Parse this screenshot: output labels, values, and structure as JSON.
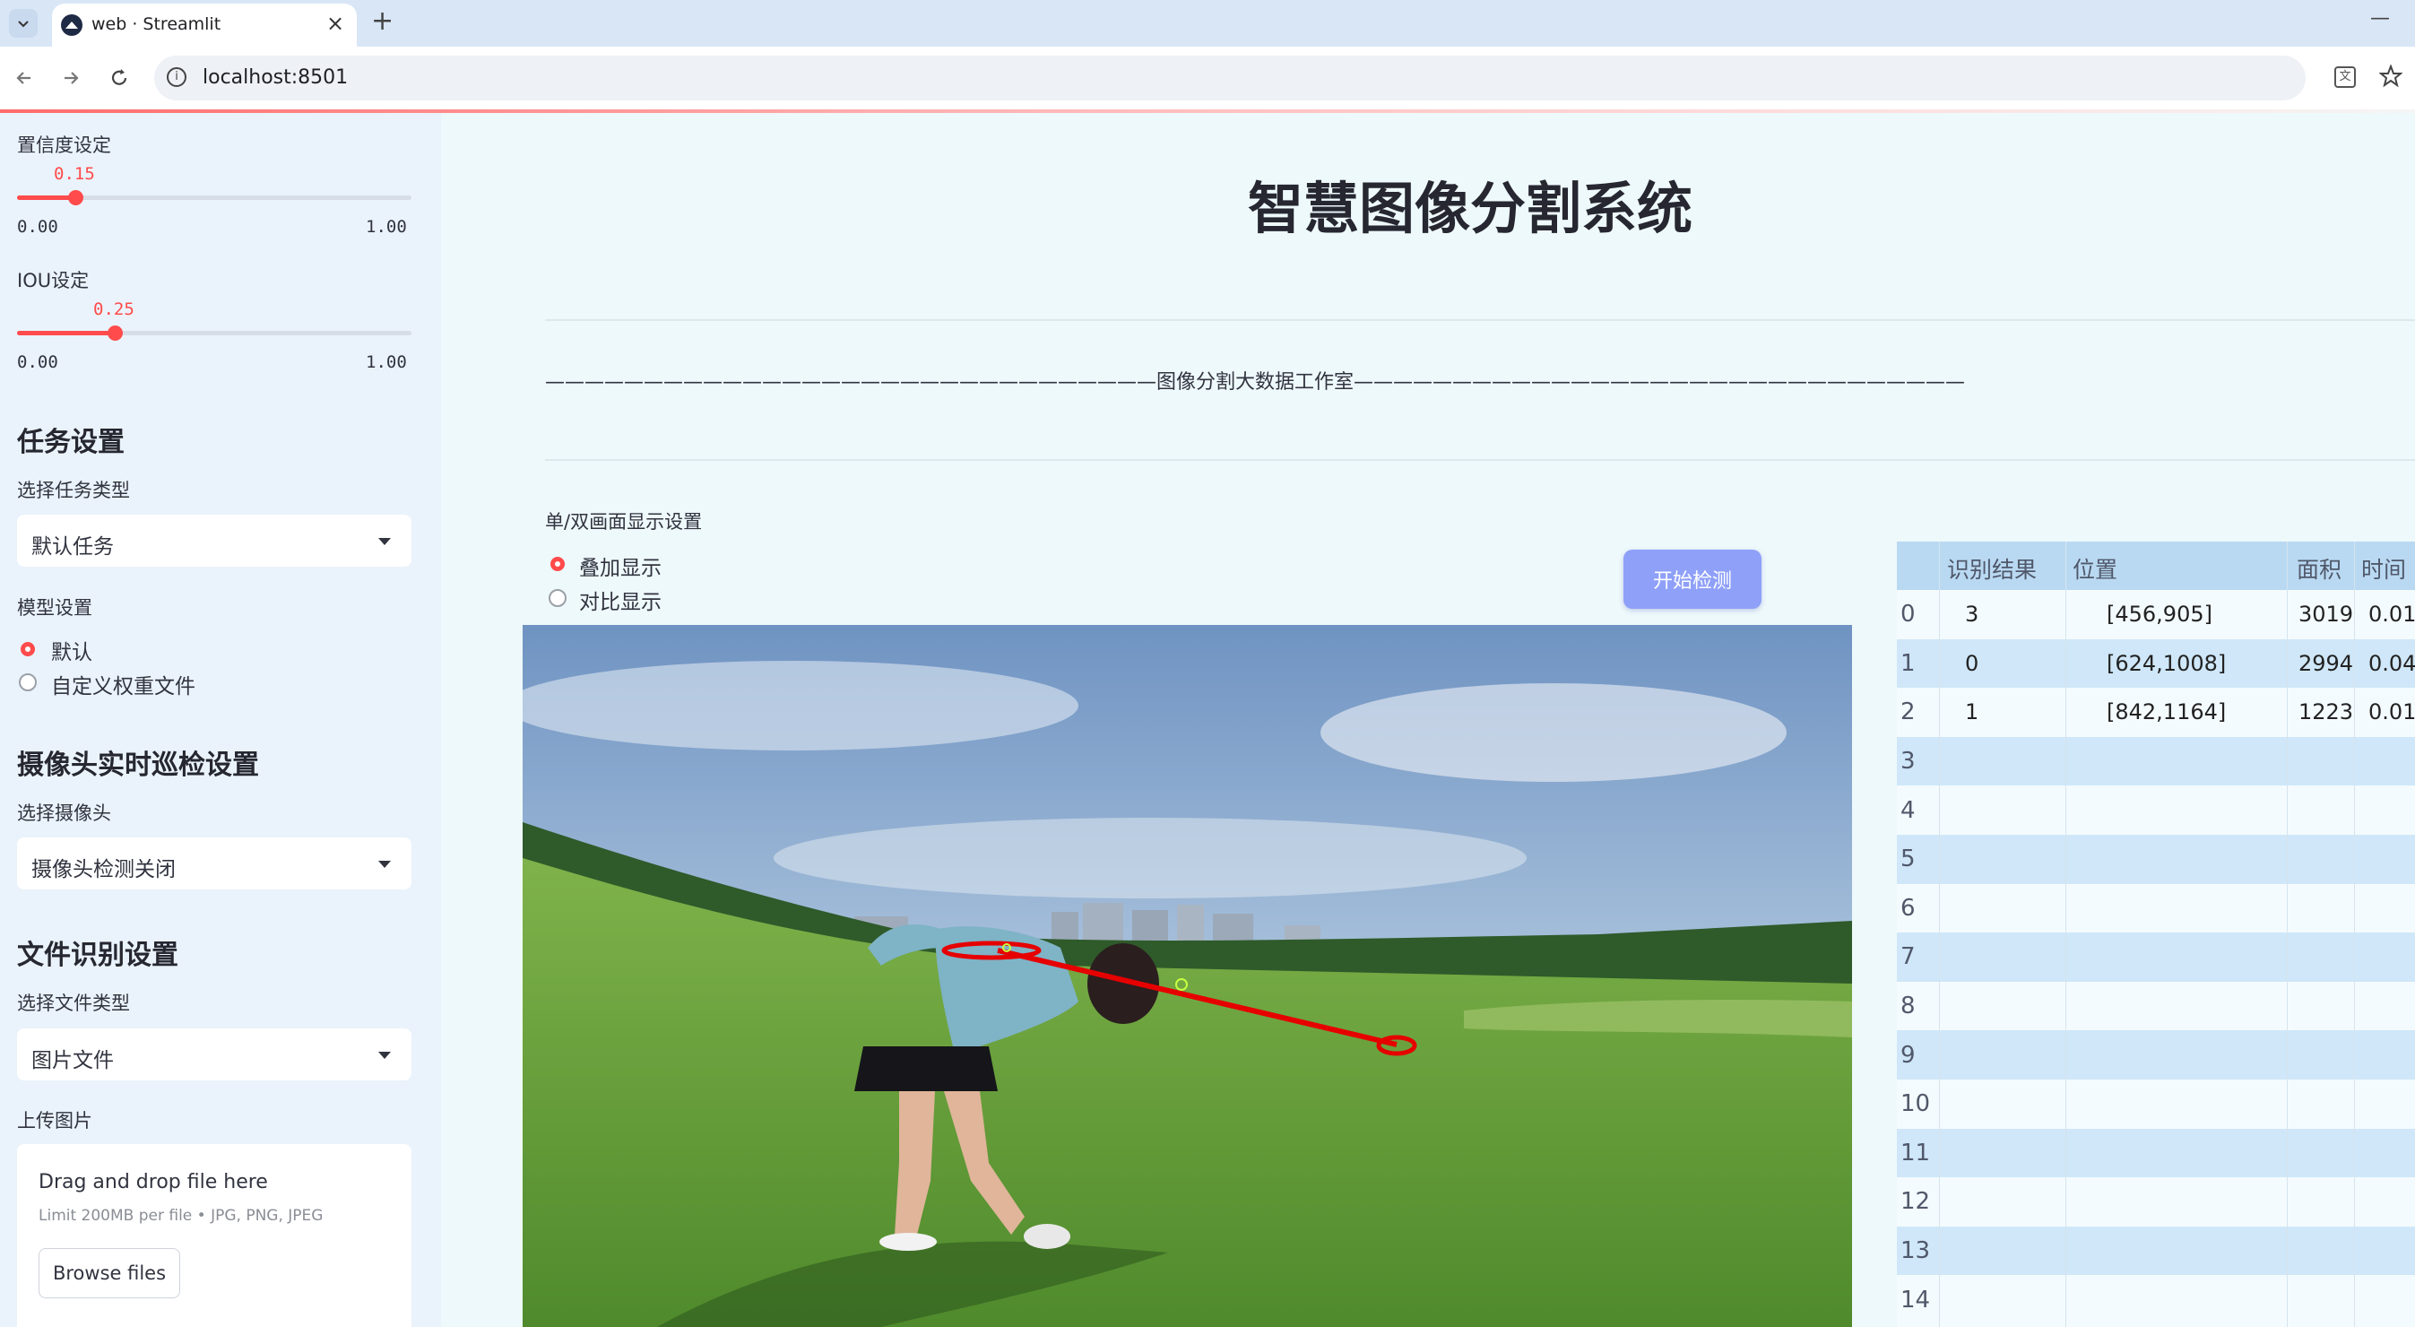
{
  "browser": {
    "tab_title": "web · Streamlit",
    "tab_close": "×",
    "new_tab": "+",
    "url": "localhost:8501",
    "minimize": "—"
  },
  "sidebar": {
    "confidence": {
      "label": "置信度设定",
      "value": "0.15",
      "value_fraction": 0.15,
      "min": "0.00",
      "max": "1.00"
    },
    "iou": {
      "label": "IOU设定",
      "value": "0.25",
      "value_fraction": 0.25,
      "min": "0.00",
      "max": "1.00"
    },
    "task_section": {
      "title": "任务设置",
      "select_label": "选择任务类型",
      "selected": "默认任务"
    },
    "model_section": {
      "label": "模型设置",
      "options": [
        "默认",
        "自定义权重文件"
      ],
      "selected_index": 0
    },
    "camera_section": {
      "title": "摄像头实时巡检设置",
      "select_label": "选择摄像头",
      "selected": "摄像头检测关闭"
    },
    "file_section": {
      "title": "文件识别设置",
      "select_label": "选择文件类型",
      "selected": "图片文件"
    },
    "upload": {
      "label": "上传图片",
      "drop_text": "Drag and drop file here",
      "limit_text": "Limit 200MB per file • JPG, PNG, JPEG",
      "browse_label": "Browse files"
    }
  },
  "main": {
    "title": "智慧图像分割系统",
    "divider_text": "———————————————————————————————图像分割大数据工作室———————————————————————————————",
    "display_setting": {
      "label": "单/双画面显示设置",
      "options": [
        "叠加显示",
        "对比显示"
      ],
      "selected_index": 0
    },
    "start_button": "开始检测"
  },
  "results_table": {
    "headers": [
      "识别结果",
      "位置",
      "面积",
      "时间"
    ],
    "rows": [
      {
        "index": "0",
        "result": "3",
        "position": "[456,905]",
        "area": "3019",
        "time": "0.01"
      },
      {
        "index": "1",
        "result": "0",
        "position": "[624,1008]",
        "area": "2994",
        "time": "0.04"
      },
      {
        "index": "2",
        "result": "1",
        "position": "[842,1164]",
        "area": "1223",
        "time": "0.01"
      },
      {
        "index": "3",
        "result": "",
        "position": "",
        "area": "",
        "time": ""
      },
      {
        "index": "4",
        "result": "",
        "position": "",
        "area": "",
        "time": ""
      },
      {
        "index": "5",
        "result": "",
        "position": "",
        "area": "",
        "time": ""
      },
      {
        "index": "6",
        "result": "",
        "position": "",
        "area": "",
        "time": ""
      },
      {
        "index": "7",
        "result": "",
        "position": "",
        "area": "",
        "time": ""
      },
      {
        "index": "8",
        "result": "",
        "position": "",
        "area": "",
        "time": ""
      },
      {
        "index": "9",
        "result": "",
        "position": "",
        "area": "",
        "time": ""
      },
      {
        "index": "10",
        "result": "",
        "position": "",
        "area": "",
        "time": ""
      },
      {
        "index": "11",
        "result": "",
        "position": "",
        "area": "",
        "time": ""
      },
      {
        "index": "12",
        "result": "",
        "position": "",
        "area": "",
        "time": ""
      },
      {
        "index": "13",
        "result": "",
        "position": "",
        "area": "",
        "time": ""
      },
      {
        "index": "14",
        "result": "",
        "position": "",
        "area": "",
        "time": ""
      }
    ]
  },
  "colors": {
    "accent": "#ff4b4b",
    "button": "#8fa0f8",
    "table_stripe": "#cfe7f8",
    "sidebar_bg": "#eaf3fb"
  }
}
